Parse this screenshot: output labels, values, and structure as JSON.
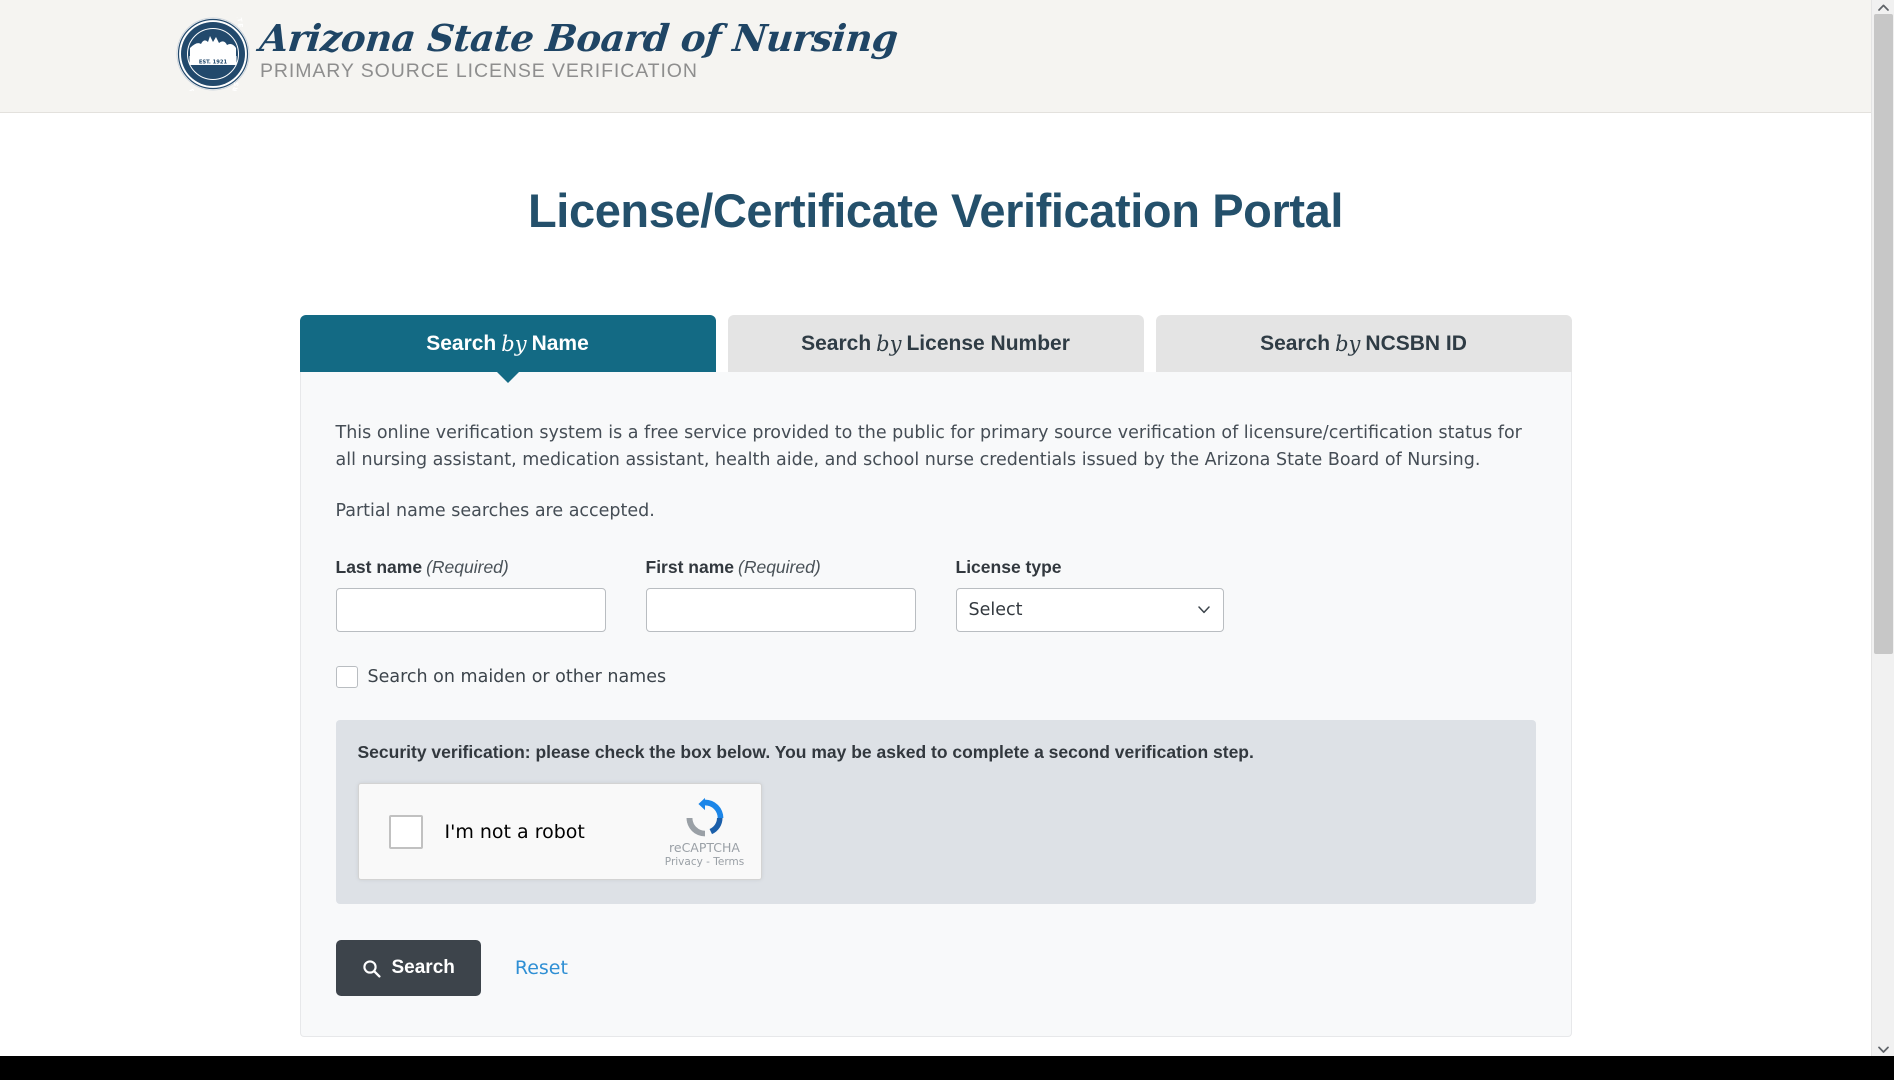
{
  "header": {
    "seal_icon": "arizona-state-board-of-nursing-seal",
    "seal_est_text": "EST. 1921",
    "seal_ring_top": "ARIZONA STATE",
    "seal_ring_bottom": "BOARD OF NURSING",
    "brand_title": "Arizona State Board of Nursing",
    "brand_subtitle": "PRIMARY SOURCE LICENSE VERIFICATION"
  },
  "page": {
    "title": "License/Certificate Verification Portal"
  },
  "tabs": [
    {
      "prefix": "Search",
      "italic": "by",
      "suffix": "Name",
      "active": true,
      "name": "tab-search-by-name"
    },
    {
      "prefix": "Search",
      "italic": "by",
      "suffix": "License Number",
      "active": false,
      "name": "tab-search-by-license-number"
    },
    {
      "prefix": "Search",
      "italic": "by",
      "suffix": "NCSBN ID",
      "active": false,
      "name": "tab-search-by-ncsbn-id"
    }
  ],
  "main": {
    "intro_paragraph": "This online verification system is a free service provided to the public for primary source verification of licensure/certification status for all nursing assistant, medication assistant, health aide, and school nurse credentials issued by the Arizona State Board of Nursing.",
    "partial_note": "Partial name searches are accepted."
  },
  "form": {
    "last_name": {
      "label": "Last name",
      "required_text": "(Required)",
      "value": "",
      "placeholder": ""
    },
    "first_name": {
      "label": "First name",
      "required_text": "(Required)",
      "value": "",
      "placeholder": ""
    },
    "license_type": {
      "label": "License type",
      "selected": "Select",
      "options": [
        "Select"
      ]
    },
    "maiden_checkbox": {
      "label": "Search on maiden or other names",
      "checked": false
    }
  },
  "captcha": {
    "heading": "Security verification: please check the box below. You may be asked to complete a second verification step.",
    "label": "I'm not a robot",
    "brand": "reCAPTCHA",
    "legal": "Privacy - Terms",
    "checked": false
  },
  "actions": {
    "search_label": "Search",
    "search_icon": "magnifier-icon",
    "reset_label": "Reset"
  },
  "colors": {
    "brand_navy": "#1f4565",
    "title_blue": "#24506b",
    "active_tab": "#136a84",
    "inactive_tab": "#e4e4e4",
    "header_bg": "#f5f4f1",
    "card_bg": "#f8f9fa",
    "captcha_panel_bg": "#dde1e6",
    "button_dark": "#3d444b",
    "link_blue": "#2f8fd4"
  }
}
